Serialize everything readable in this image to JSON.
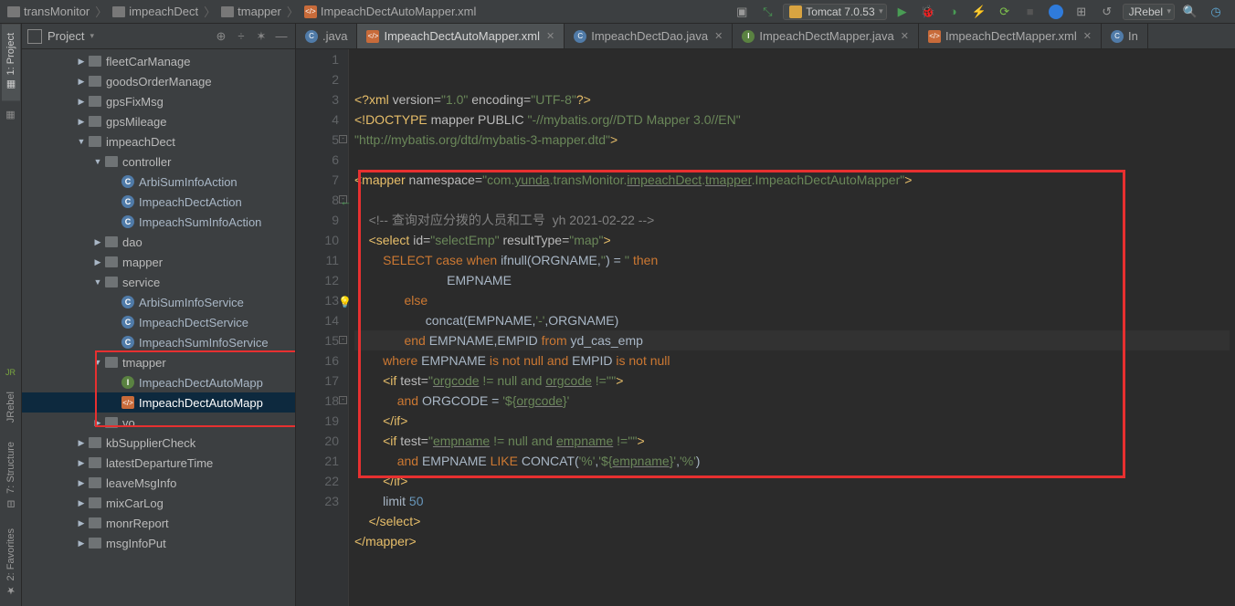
{
  "breadcrumbs": [
    "transMonitor",
    "impeachDect",
    "tmapper",
    "ImpeachDectAutoMapper.xml"
  ],
  "runConfig": "Tomcat 7.0.53",
  "jrebel": "JRebel",
  "leftRail": {
    "project": "1: Project",
    "structure": "7: Structure",
    "favorites": "2: Favorites"
  },
  "sidebar": {
    "title": "Project",
    "tree": [
      {
        "depth": 3,
        "arrow": "▶",
        "icon": "pkg",
        "label": "fleetCarManage"
      },
      {
        "depth": 3,
        "arrow": "▶",
        "icon": "pkg",
        "label": "goodsOrderManage"
      },
      {
        "depth": 3,
        "arrow": "▶",
        "icon": "pkg",
        "label": "gpsFixMsg"
      },
      {
        "depth": 3,
        "arrow": "▶",
        "icon": "pkg",
        "label": "gpsMileage"
      },
      {
        "depth": 3,
        "arrow": "▼",
        "icon": "pkg",
        "label": "impeachDect"
      },
      {
        "depth": 4,
        "arrow": "▼",
        "icon": "pkg",
        "label": "controller"
      },
      {
        "depth": 5,
        "arrow": "",
        "icon": "class",
        "label": "ArbiSumInfoAction"
      },
      {
        "depth": 5,
        "arrow": "",
        "icon": "class",
        "label": "ImpeachDectAction"
      },
      {
        "depth": 5,
        "arrow": "",
        "icon": "class",
        "label": "ImpeachSumInfoAction"
      },
      {
        "depth": 4,
        "arrow": "▶",
        "icon": "pkg",
        "label": "dao"
      },
      {
        "depth": 4,
        "arrow": "▶",
        "icon": "pkg",
        "label": "mapper"
      },
      {
        "depth": 4,
        "arrow": "▼",
        "icon": "pkg",
        "label": "service"
      },
      {
        "depth": 5,
        "arrow": "",
        "icon": "class",
        "label": "ArbiSumInfoService"
      },
      {
        "depth": 5,
        "arrow": "",
        "icon": "class",
        "label": "ImpeachDectService"
      },
      {
        "depth": 5,
        "arrow": "",
        "icon": "class",
        "label": "ImpeachSumInfoService"
      },
      {
        "depth": 4,
        "arrow": "▼",
        "icon": "pkg",
        "label": "tmapper"
      },
      {
        "depth": 5,
        "arrow": "",
        "icon": "iface",
        "label": "ImpeachDectAutoMapp"
      },
      {
        "depth": 5,
        "arrow": "",
        "icon": "xml",
        "label": "ImpeachDectAutoMapp",
        "selected": true
      },
      {
        "depth": 4,
        "arrow": "▶",
        "icon": "pkg",
        "label": "vo"
      },
      {
        "depth": 3,
        "arrow": "▶",
        "icon": "pkg",
        "label": "kbSupplierCheck"
      },
      {
        "depth": 3,
        "arrow": "▶",
        "icon": "pkg",
        "label": "latestDepartureTime"
      },
      {
        "depth": 3,
        "arrow": "▶",
        "icon": "pkg",
        "label": "leaveMsgInfo"
      },
      {
        "depth": 3,
        "arrow": "▶",
        "icon": "pkg",
        "label": "mixCarLog"
      },
      {
        "depth": 3,
        "arrow": "▶",
        "icon": "pkg",
        "label": "monrReport"
      },
      {
        "depth": 3,
        "arrow": "▶",
        "icon": "pkg",
        "label": "msgInfoPut"
      }
    ]
  },
  "tabs": [
    {
      "icon": "java",
      "label": ".java",
      "active": false,
      "partial": true
    },
    {
      "icon": "xml",
      "label": "ImpeachDectAutoMapper.xml",
      "active": true
    },
    {
      "icon": "java",
      "label": "ImpeachDectDao.java",
      "active": false
    },
    {
      "icon": "iface",
      "label": "ImpeachDectMapper.java",
      "active": false
    },
    {
      "icon": "xml",
      "label": "ImpeachDectMapper.xml",
      "active": false
    },
    {
      "icon": "java",
      "label": "In",
      "active": false,
      "partial": true
    }
  ],
  "code": {
    "lines": [
      {
        "n": 1,
        "html": "<span class='tag'>&lt;?xml</span> <span class='attr'>version=</span><span class='str'>\"1.0\"</span> <span class='attr'>encoding=</span><span class='str'>\"UTF-8\"</span><span class='tag'>?&gt;</span>"
      },
      {
        "n": 2,
        "html": "<span class='tag'>&lt;!DOCTYPE</span> <span class='attr'>mapper</span> <span class='attr'>PUBLIC</span> <span class='str'>\"-//mybatis.org//DTD Mapper 3.0//EN\"</span>"
      },
      {
        "n": 3,
        "html": "<span class='str'>\"http://mybatis.org/dtd/mybatis-3-mapper.dtd\"</span><span class='tag'>&gt;</span>"
      },
      {
        "n": 4,
        "html": ""
      },
      {
        "n": 5,
        "html": "<span class='tag'>&lt;mapper</span> <span class='attr'>namespace=</span><span class='str'>\"com.<span class='underline'>yunda</span>.transMonitor.<span class='underline'>impeachDect</span>.<span class='underline'>tmapper</span>.ImpeachDectAutoMapper\"</span><span class='tag'>&gt;</span>",
        "collapse": true
      },
      {
        "n": 6,
        "html": ""
      },
      {
        "n": 7,
        "html": "    <span class='cmt'>&lt;!-- 查询对应分拨的人员和工号  yh 2021-02-22 --&gt;</span>"
      },
      {
        "n": 8,
        "html": "    <span class='tag'>&lt;select</span> <span class='attr'>id=</span><span class='str'>\"selectEmp\"</span> <span class='attr'>resultType=</span><span class='str'>\"map\"</span><span class='tag'>&gt;</span>",
        "collapse": true,
        "back": true
      },
      {
        "n": 9,
        "html": "        <span class='sql-kw'>SELECT</span> <span class='sql-kw'>case</span> <span class='sql-kw'>when</span> <span class='sql-id'>ifnull(ORGNAME,</span><span class='str'>''</span><span class='sql-id'>) = </span><span class='str'>''</span> <span class='sql-kw'>then</span>"
      },
      {
        "n": 10,
        "html": "                          <span class='sql-id'>EMPNAME</span>"
      },
      {
        "n": 11,
        "html": "              <span class='sql-kw'>else</span>"
      },
      {
        "n": 12,
        "html": "                    <span class='sql-id'>concat(EMPNAME,</span><span class='str'>'-'</span><span class='sql-id'>,ORGNAME)</span>"
      },
      {
        "n": 13,
        "html": "              <span class='sql-kw'>end</span> <span class='sql-id'>EMPNAME,EMPID</span> <span class='sql-kw'>from</span> <span class='sql-id'>yd_cas_emp</span>",
        "bulb": true,
        "hl": true
      },
      {
        "n": 14,
        "html": "        <span class='sql-kw'>where</span> <span class='sql-id'>EMPNAME</span> <span class='sql-kw'>is not null and</span> <span class='sql-id'>EMPID</span> <span class='sql-kw'>is not null</span>"
      },
      {
        "n": 15,
        "html": "        <span class='tag'>&lt;if</span> <span class='attr'>test=</span><span class='str'>\"<span class='underline'>orgcode</span> != null and <span class='underline'>orgcode</span> !=''\"</span><span class='tag'>&gt;</span>",
        "collapse": true
      },
      {
        "n": 16,
        "html": "            <span class='sql-kw'>and</span> <span class='sql-id'>ORGCODE = </span><span class='str'>'${<span class='underline'>orgcode</span>}'</span>"
      },
      {
        "n": 17,
        "html": "        <span class='tag'>&lt;/if&gt;</span>"
      },
      {
        "n": 18,
        "html": "        <span class='tag'>&lt;if</span> <span class='attr'>test=</span><span class='str'>\"<span class='underline'>empname</span> != null and <span class='underline'>empname</span> !=''\"</span><span class='tag'>&gt;</span>",
        "collapse": true
      },
      {
        "n": 19,
        "html": "            <span class='sql-kw'>and</span> <span class='sql-id'>EMPNAME</span> <span class='sql-kw'>LIKE</span> <span class='sql-id'>CONCAT(</span><span class='str'>'%'</span><span class='sql-id'>,</span><span class='str'>'${<span class='underline'>empname</span>}'</span><span class='sql-id'>,</span><span class='str'>'%'</span><span class='sql-id'>)</span>"
      },
      {
        "n": 20,
        "html": "        <span class='tag'>&lt;/if&gt;</span>"
      },
      {
        "n": 21,
        "html": "        <span class='sql-id'>limit</span> <span class='num'>50</span>"
      },
      {
        "n": 22,
        "html": "    <span class='tag'>&lt;/select&gt;</span>"
      },
      {
        "n": 23,
        "html": "<span class='tag'>&lt;/mapper&gt;</span>"
      }
    ]
  }
}
